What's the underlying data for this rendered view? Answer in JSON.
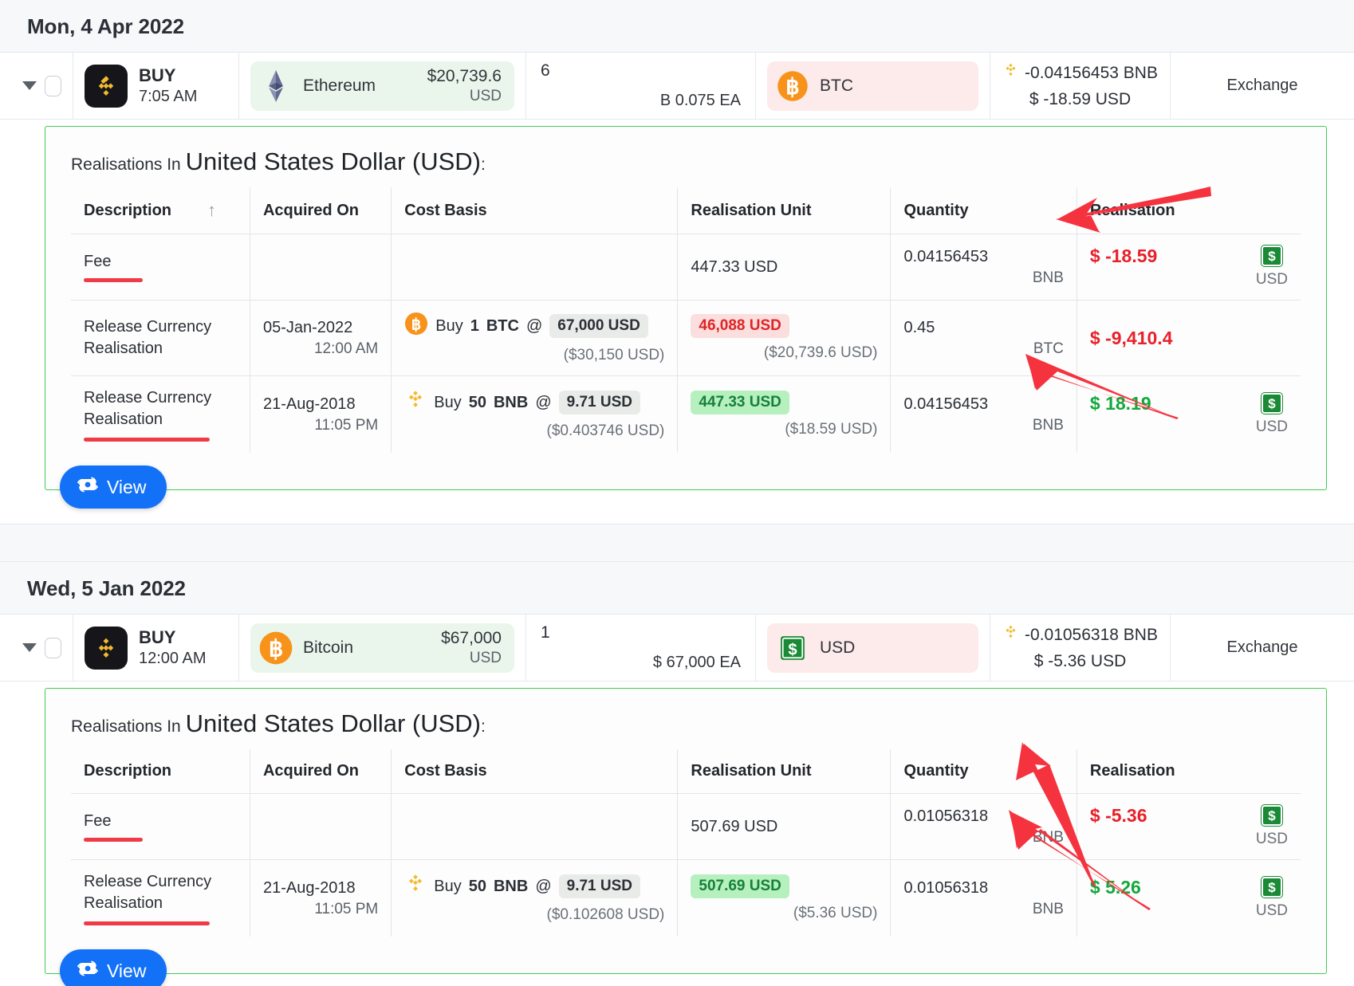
{
  "sections": [
    {
      "date_label": "Mon, 4 Apr 2022",
      "txn": {
        "type_label": "BUY",
        "time": "7:05 AM",
        "exchange_icon": "binance-icon",
        "asset": {
          "icon": "ethereum-icon",
          "name": "Ethereum",
          "amount": "$20,739.6",
          "currency": "USD",
          "tone": "positive"
        },
        "quantity": {
          "value": "6",
          "unit_price": "B 0.075 EA"
        },
        "counter_asset": {
          "icon": "bitcoin-icon",
          "name": "BTC",
          "tone": "negative"
        },
        "fee": {
          "icon": "bnb-icon",
          "amount": "-0.04156453 BNB",
          "fiat": "$ -18.59 USD"
        },
        "source_label": "Exchange"
      },
      "panel": {
        "title_prefix": "Realisations In",
        "title_currency": "United States Dollar (USD)",
        "title_suffix": ":",
        "columns": [
          "Description",
          "Acquired On",
          "Cost Basis",
          "Realisation Unit",
          "Quantity",
          "Realisation"
        ],
        "sort_indicator": "↑",
        "rows": [
          {
            "description": "Fee",
            "desc_underline": "short",
            "acquired_date": "",
            "acquired_time": "",
            "cost_icon": "",
            "cost_action": "",
            "cost_qty": "",
            "cost_asset": "",
            "cost_price_chip": "",
            "cost_sub": "",
            "unit_chip": "",
            "unit_chip_tone": "none",
            "unit_plain": "447.33 USD",
            "unit_sub": "",
            "quantity": "0.04156453",
            "quantity_unit": "BNB",
            "realisation": "$ -18.59",
            "realisation_tone": "neg",
            "realisation_badge": "usd-badge",
            "realisation_unit": "USD"
          },
          {
            "description": "Release Currency Realisation",
            "desc_underline": "none",
            "acquired_date": "05-Jan-2022",
            "acquired_time": "12:00 AM",
            "cost_icon": "bitcoin-icon",
            "cost_action": "Buy",
            "cost_qty": "1",
            "cost_asset": "BTC",
            "cost_at": "@",
            "cost_price_chip": "67,000 USD",
            "cost_sub": "($30,150 USD)",
            "unit_chip": "46,088 USD",
            "unit_chip_tone": "red",
            "unit_plain": "",
            "unit_sub": "($20,739.6 USD)",
            "quantity": "0.45",
            "quantity_unit": "BTC",
            "realisation": "$ -9,410.4",
            "realisation_tone": "neg",
            "realisation_badge": "",
            "realisation_unit": ""
          },
          {
            "description": "Release Currency Realisation",
            "desc_underline": "long",
            "acquired_date": "21-Aug-2018",
            "acquired_time": "11:05 PM",
            "cost_icon": "bnb-icon",
            "cost_action": "Buy",
            "cost_qty": "50",
            "cost_asset": "BNB",
            "cost_at": "@",
            "cost_price_chip": "9.71 USD",
            "cost_sub": "($0.403746 USD)",
            "unit_chip": "447.33 USD",
            "unit_chip_tone": "green",
            "unit_plain": "",
            "unit_sub": "($18.59 USD)",
            "quantity": "0.04156453",
            "quantity_unit": "BNB",
            "realisation": "$ 18.19",
            "realisation_tone": "pos",
            "realisation_badge": "usd-badge",
            "realisation_unit": "USD"
          }
        ],
        "view_label": "View",
        "view_icon": "money-exchange-icon"
      }
    },
    {
      "date_label": "Wed, 5 Jan 2022",
      "txn": {
        "type_label": "BUY",
        "time": "12:00 AM",
        "exchange_icon": "binance-icon",
        "asset": {
          "icon": "bitcoin-icon",
          "name": "Bitcoin",
          "amount": "$67,000",
          "currency": "USD",
          "tone": "positive"
        },
        "quantity": {
          "value": "1",
          "unit_price": "$ 67,000 EA"
        },
        "counter_asset": {
          "icon": "usd-icon",
          "name": "USD",
          "tone": "negative"
        },
        "fee": {
          "icon": "bnb-icon",
          "amount": "-0.01056318 BNB",
          "fiat": "$ -5.36 USD"
        },
        "source_label": "Exchange"
      },
      "panel": {
        "title_prefix": "Realisations In",
        "title_currency": "United States Dollar (USD)",
        "title_suffix": ":",
        "columns": [
          "Description",
          "Acquired On",
          "Cost Basis",
          "Realisation Unit",
          "Quantity",
          "Realisation"
        ],
        "sort_indicator": "",
        "rows": [
          {
            "description": "Fee",
            "desc_underline": "short",
            "acquired_date": "",
            "acquired_time": "",
            "cost_icon": "",
            "cost_action": "",
            "cost_qty": "",
            "cost_asset": "",
            "cost_price_chip": "",
            "cost_sub": "",
            "unit_chip": "",
            "unit_chip_tone": "none",
            "unit_plain": "507.69 USD",
            "unit_sub": "",
            "quantity": "0.01056318",
            "quantity_unit": "BNB",
            "realisation": "$ -5.36",
            "realisation_tone": "neg",
            "realisation_badge": "usd-badge",
            "realisation_unit": "USD"
          },
          {
            "description": "Release Currency Realisation",
            "desc_underline": "long",
            "acquired_date": "21-Aug-2018",
            "acquired_time": "11:05 PM",
            "cost_icon": "bnb-icon",
            "cost_action": "Buy",
            "cost_qty": "50",
            "cost_asset": "BNB",
            "cost_at": "@",
            "cost_price_chip": "9.71 USD",
            "cost_sub": "($0.102608 USD)",
            "unit_chip": "507.69 USD",
            "unit_chip_tone": "green",
            "unit_plain": "",
            "unit_sub": "($5.36 USD)",
            "quantity": "0.01056318",
            "quantity_unit": "BNB",
            "realisation": "$ 5.26",
            "realisation_tone": "pos",
            "realisation_badge": "usd-badge",
            "realisation_unit": "USD"
          }
        ],
        "view_label": "View",
        "view_icon": "money-exchange-icon"
      }
    }
  ],
  "colors": {
    "accent_blue": "#1271f7",
    "positive_green": "#12a83b",
    "negative_red": "#e8202a",
    "panel_border_green": "#3fce52",
    "annotation_red": "#f5333f",
    "bnb_yellow": "#f3ba2f",
    "btc_orange": "#f7931a",
    "usd_green": "#1b8a36"
  },
  "annotations": {
    "arrow_count": 4,
    "arrow_color": "#f5333f"
  }
}
